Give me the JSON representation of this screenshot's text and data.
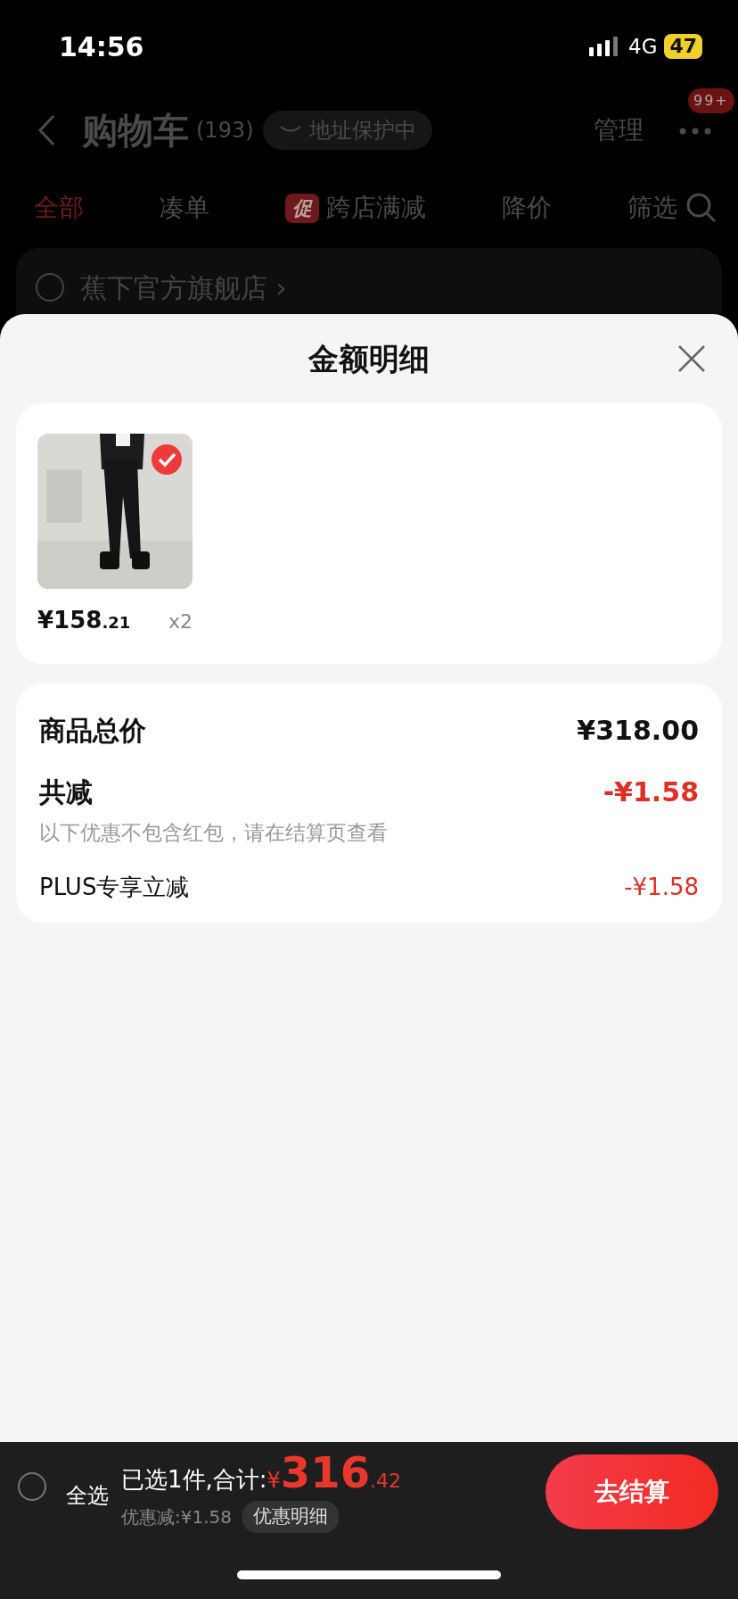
{
  "status_bar": {
    "time": "14:56",
    "network": "4G",
    "battery": "47"
  },
  "header": {
    "title": "购物车",
    "count": "(193)",
    "address_badge": "地址保护中",
    "manage": "管理",
    "more_badge": "99+"
  },
  "tabs": [
    {
      "label": "全部",
      "selected": true
    },
    {
      "label": "凑单",
      "selected": false
    },
    {
      "label": "跨店满减",
      "selected": false,
      "tag": "促"
    },
    {
      "label": "降价",
      "selected": false
    },
    {
      "label": "筛选",
      "selected": false,
      "kind": "filter"
    }
  ],
  "store": {
    "name": "蕉下官方旗舰店 ›",
    "checked": false
  },
  "sheet": {
    "title": "金额明细",
    "items": [
      {
        "kind": "picture",
        "price_main": "¥158",
        "price_decimal": ".21",
        "quantity": "x2",
        "selected": true
      }
    ],
    "summary": [
      {
        "kind": "total",
        "label": "商品总价",
        "amount": "¥318.00"
      },
      {
        "kind": "discount",
        "label": "共减",
        "amount": "-¥1.58",
        "note": "以下优惠不包含红包，请在结算页查看"
      },
      {
        "kind": "item",
        "label": "PLUS专享立减",
        "amount": "-¥1.58"
      }
    ]
  },
  "bottom_bar": {
    "select_all": {
      "label": "全选",
      "checked": false
    },
    "selected_text": "已选1件,合计:",
    "currency": "¥",
    "total_main": "316",
    "total_decimal": ".42",
    "discount": "优惠减:¥1.58",
    "detail_button": "优惠明细",
    "checkout": "去结算"
  }
}
